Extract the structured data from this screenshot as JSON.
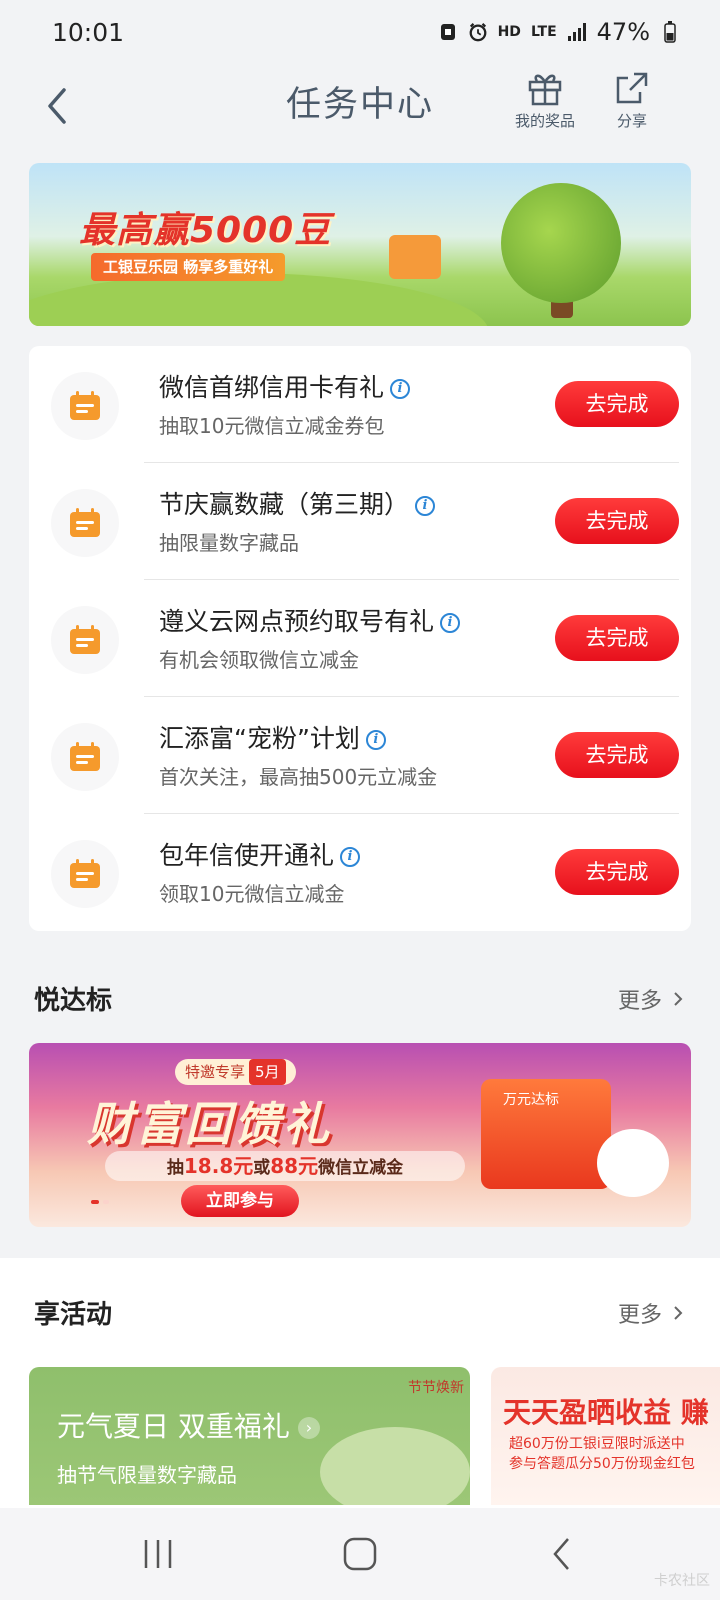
{
  "status_bar": {
    "time": "10:01",
    "hd": "HD",
    "network": "LTE",
    "battery": "47%"
  },
  "header": {
    "title": "任务中心",
    "prizes_label": "我的奖品",
    "share_label": "分享"
  },
  "banner_top": {
    "title": "最高赢5000豆",
    "subtitle": "工银豆乐园 畅享多重好礼"
  },
  "tasks": [
    {
      "name": "微信首绑信用卡有礼",
      "desc": "抽取10元微信立减金券包",
      "button": "去完成"
    },
    {
      "name": "节庆赢数藏（第三期）",
      "desc": "抽限量数字藏品",
      "button": "去完成"
    },
    {
      "name": "遵义云网点预约取号有礼",
      "desc": "有机会领取微信立减金",
      "button": "去完成"
    },
    {
      "name": "汇添富“宠粉”计划",
      "desc": "首次关注，最高抽500元立减金",
      "button": "去完成"
    },
    {
      "name": "包年信使开通礼",
      "desc": "领取10元微信立减金",
      "button": "去完成"
    }
  ],
  "section_yue": {
    "title": "悦达标",
    "more": "更多"
  },
  "banner_wealth": {
    "tag": "特邀专享",
    "month": "5月",
    "title": "财富回馈礼",
    "sub_prefix": "抽",
    "amount1": "18.8元",
    "sub_mid": "或",
    "amount2": "88元",
    "sub_suffix": "微信立减金",
    "button": "立即参与",
    "box_label": "万元达标"
  },
  "section_activity": {
    "title": "享活动",
    "more": "更多"
  },
  "card_left": {
    "title": "元气夏日 双重福礼",
    "subtitle": "抽节气限量数字藏品",
    "tag": "节节焕新"
  },
  "card_right": {
    "title": "天天盈晒收益 赚",
    "line1": "超60万份工银i豆限时派送中",
    "line2": "参与答题瓜分50万份现金红包"
  },
  "watermark": "卡农社区",
  "colors": {
    "accent_red": "#e7101c",
    "icon_orange": "#f59a2c",
    "info_blue": "#2c86d6"
  }
}
